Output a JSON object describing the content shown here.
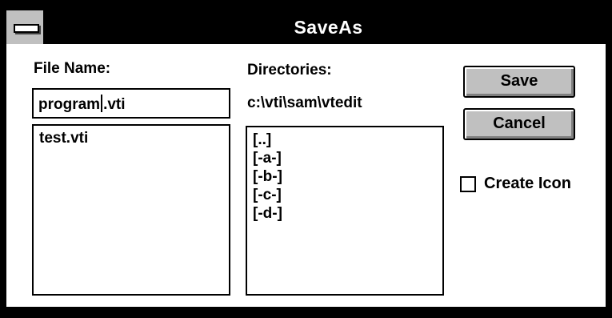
{
  "window": {
    "title": "SaveAs"
  },
  "file_name": {
    "label": "File Name:",
    "value_before_caret": "program",
    "value_after_caret": ".vti",
    "files": [
      "test.vti"
    ]
  },
  "directories": {
    "label": "Directories:",
    "current_path": "c:\\vti\\sam\\vtedit",
    "items": [
      "[..]",
      "[-a-]",
      "[-b-]",
      "[-c-]",
      "[-d-]"
    ]
  },
  "buttons": {
    "save": "Save",
    "cancel": "Cancel"
  },
  "create_icon": {
    "label": "Create Icon",
    "checked": false
  },
  "colors": {
    "face": "#c0c0c0",
    "frame": "#000000",
    "client": "#ffffff",
    "title_text": "#ffffff"
  },
  "icons": {
    "system_menu": "system-menu-icon"
  }
}
